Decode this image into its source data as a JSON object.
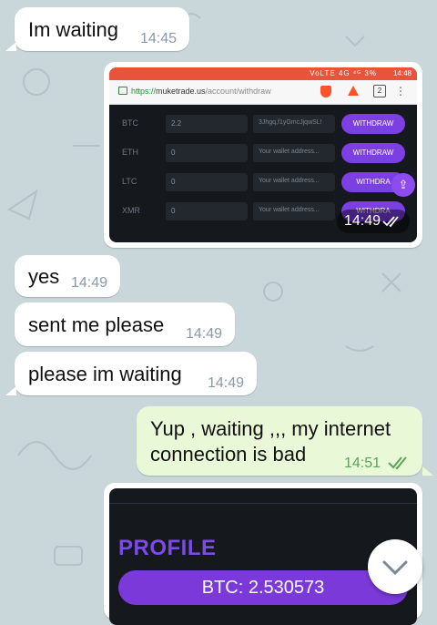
{
  "messages": {
    "m1": {
      "text": "Im waiting",
      "time": "14:45"
    },
    "m2": {
      "text": "yes",
      "time": "14:49"
    },
    "m3": {
      "text": "sent me please",
      "time": "14:49"
    },
    "m4": {
      "text": "please im waiting",
      "time": "14:49"
    },
    "m5": {
      "line1": "Yup , waiting ,,, my internet",
      "line2": "connection is bad",
      "time": "14:51"
    }
  },
  "photo1": {
    "time": "14:49",
    "status_time": "14:48",
    "status_icons": "VoLTE 4G ⁴ᴳ 3%",
    "url_prefix": "https://",
    "url_domain": "muketrade.us",
    "url_path": "/account/withdraw",
    "tab_count": "2",
    "rows": [
      {
        "coin": "BTC",
        "amount": "2.2",
        "wallet": "3Jhgq,f1yGmcJjqwSL!",
        "button": "WITHDRAW"
      },
      {
        "coin": "ETH",
        "amount": "0",
        "wallet": "Your wallet address...",
        "button": "WITHDRAW"
      },
      {
        "coin": "LTC",
        "amount": "0",
        "wallet": "Your wallet address...",
        "button": "WITHDRA"
      },
      {
        "coin": "XMR",
        "amount": "0",
        "wallet": "Your wallet address...",
        "button": "WITHDRA"
      }
    ]
  },
  "photo2": {
    "heading": "PROFILE",
    "balance": "BTC: 2.530573"
  },
  "colors": {
    "chat_bg": "#c9d6da",
    "incoming": "#ffffff",
    "outgoing": "#e9f9d8",
    "withdraw_purple": "#7b3fe4",
    "read_check": "#5aa35a"
  },
  "icons": {
    "read_receipt": "double-check-icon",
    "scroll_down": "chevron-down-icon"
  }
}
